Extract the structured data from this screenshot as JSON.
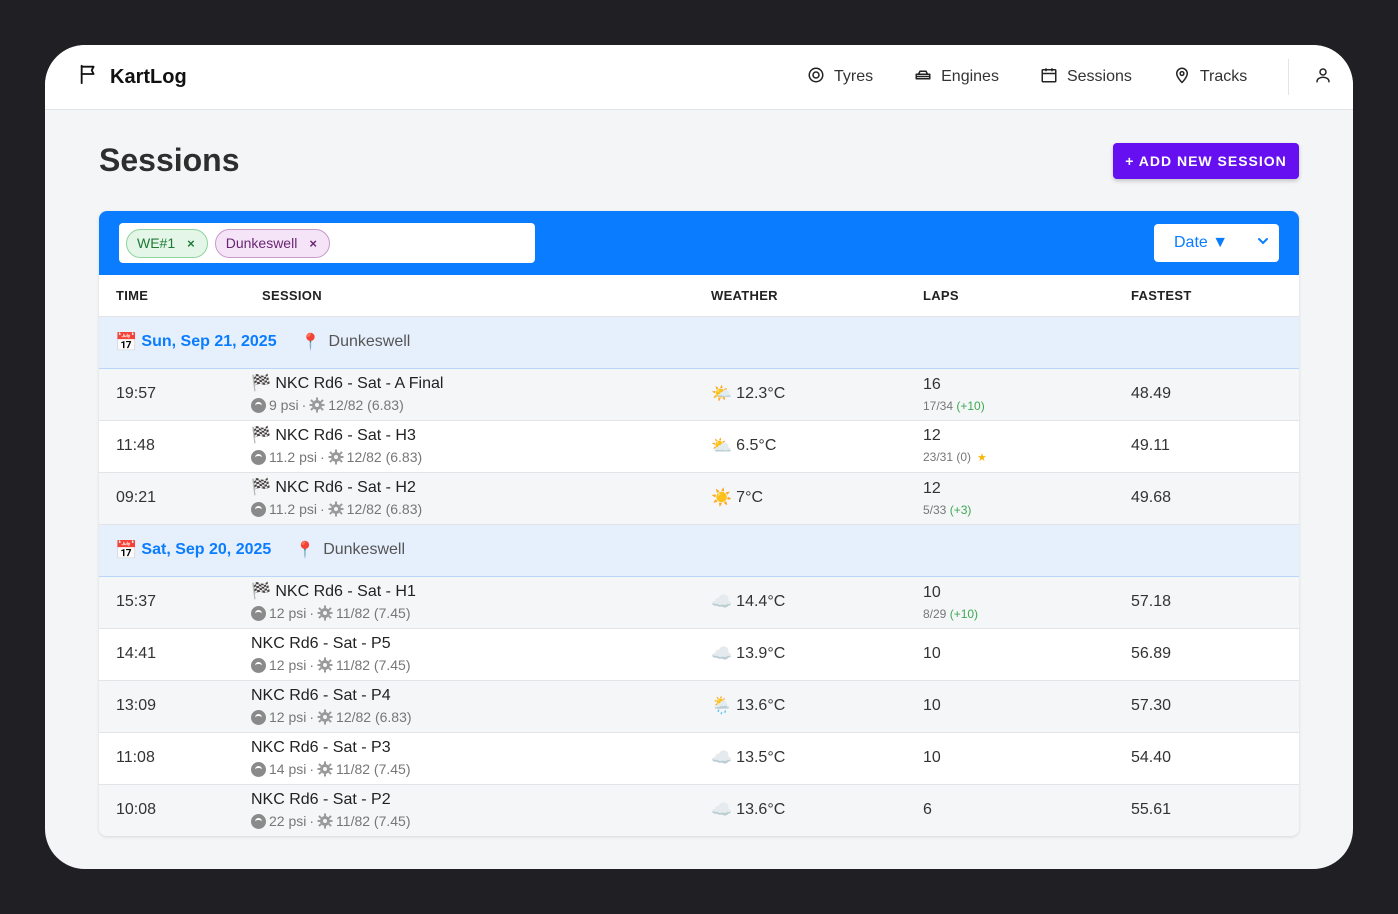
{
  "app": {
    "name": "KartLog"
  },
  "nav": [
    {
      "label": "Tyres",
      "icon": "tyre-icon"
    },
    {
      "label": "Engines",
      "icon": "engine-icon"
    },
    {
      "label": "Sessions",
      "icon": "calendar-icon"
    },
    {
      "label": "Tracks",
      "icon": "map-pin-icon"
    }
  ],
  "page": {
    "title": "Sessions",
    "add_button": "+ ADD NEW SESSION"
  },
  "filters": {
    "chips": [
      {
        "label": "WE#1",
        "remove": "×"
      },
      {
        "label": "Dunkeswell",
        "remove": "×"
      }
    ],
    "sort": {
      "selected": "Date ▼"
    }
  },
  "columns": [
    "TIME",
    "SESSION",
    "WEATHER",
    "LAPS",
    "FASTEST"
  ],
  "groups": [
    {
      "date_icon": "📅",
      "date": "Sun, Sep 21, 2025",
      "track_icon": "📍",
      "track": "Dunkeswell",
      "sessions": [
        {
          "time": "19:57",
          "flag": "🏁",
          "name": "NKC Rd6 - Sat - A Final",
          "pressure": "9 psi",
          "gearing": "12/82 (6.83)",
          "weather_icon": "🌤️",
          "temp": "12.3°C",
          "laps": "16",
          "position": "17/34",
          "gain": "(+10)",
          "gain_type": "plus",
          "star": "",
          "fastest": "48.49"
        },
        {
          "time": "11:48",
          "flag": "🏁",
          "name": "NKC Rd6 - Sat - H3",
          "pressure": "11.2 psi",
          "gearing": "12/82 (6.83)",
          "weather_icon": "⛅",
          "temp": "6.5°C",
          "laps": "12",
          "position": "23/31",
          "gain": "(0)",
          "gain_type": "zero",
          "star": "★",
          "fastest": "49.11"
        },
        {
          "time": "09:21",
          "flag": "🏁",
          "name": "NKC Rd6 - Sat - H2",
          "pressure": "11.2 psi",
          "gearing": "12/82 (6.83)",
          "weather_icon": "☀️",
          "temp": "7°C",
          "laps": "12",
          "position": "5/33",
          "gain": "(+3)",
          "gain_type": "plus",
          "star": "",
          "fastest": "49.68"
        }
      ]
    },
    {
      "date_icon": "📅",
      "date": "Sat, Sep 20, 2025",
      "track_icon": "📍",
      "track": "Dunkeswell",
      "sessions": [
        {
          "time": "15:37",
          "flag": "🏁",
          "name": "NKC Rd6 - Sat - H1",
          "pressure": "12 psi",
          "gearing": "11/82 (7.45)",
          "weather_icon": "☁️",
          "temp": "14.4°C",
          "laps": "10",
          "position": "8/29",
          "gain": "(+10)",
          "gain_type": "plus",
          "star": "",
          "fastest": "57.18"
        },
        {
          "time": "14:41",
          "flag": "",
          "name": "NKC Rd6 - Sat - P5",
          "pressure": "12 psi",
          "gearing": "11/82 (7.45)",
          "weather_icon": "☁️",
          "temp": "13.9°C",
          "laps": "10",
          "position": "",
          "gain": "",
          "gain_type": "",
          "star": "",
          "fastest": "56.89"
        },
        {
          "time": "13:09",
          "flag": "",
          "name": "NKC Rd6 - Sat - P4",
          "pressure": "12 psi",
          "gearing": "12/82 (6.83)",
          "weather_icon": "🌦️",
          "temp": "13.6°C",
          "laps": "10",
          "position": "",
          "gain": "",
          "gain_type": "",
          "star": "",
          "fastest": "57.30"
        },
        {
          "time": "11:08",
          "flag": "",
          "name": "NKC Rd6 - Sat - P3",
          "pressure": "14 psi",
          "gearing": "11/82 (7.45)",
          "weather_icon": "☁️",
          "temp": "13.5°C",
          "laps": "10",
          "position": "",
          "gain": "",
          "gain_type": "",
          "star": "",
          "fastest": "54.40"
        },
        {
          "time": "10:08",
          "flag": "",
          "name": "NKC Rd6 - Sat - P2",
          "pressure": "22 psi",
          "gearing": "11/82 (7.45)",
          "weather_icon": "☁️",
          "temp": "13.6°C",
          "laps": "6",
          "position": "",
          "gain": "",
          "gain_type": "",
          "star": "",
          "fastest": "55.61"
        }
      ]
    }
  ]
}
